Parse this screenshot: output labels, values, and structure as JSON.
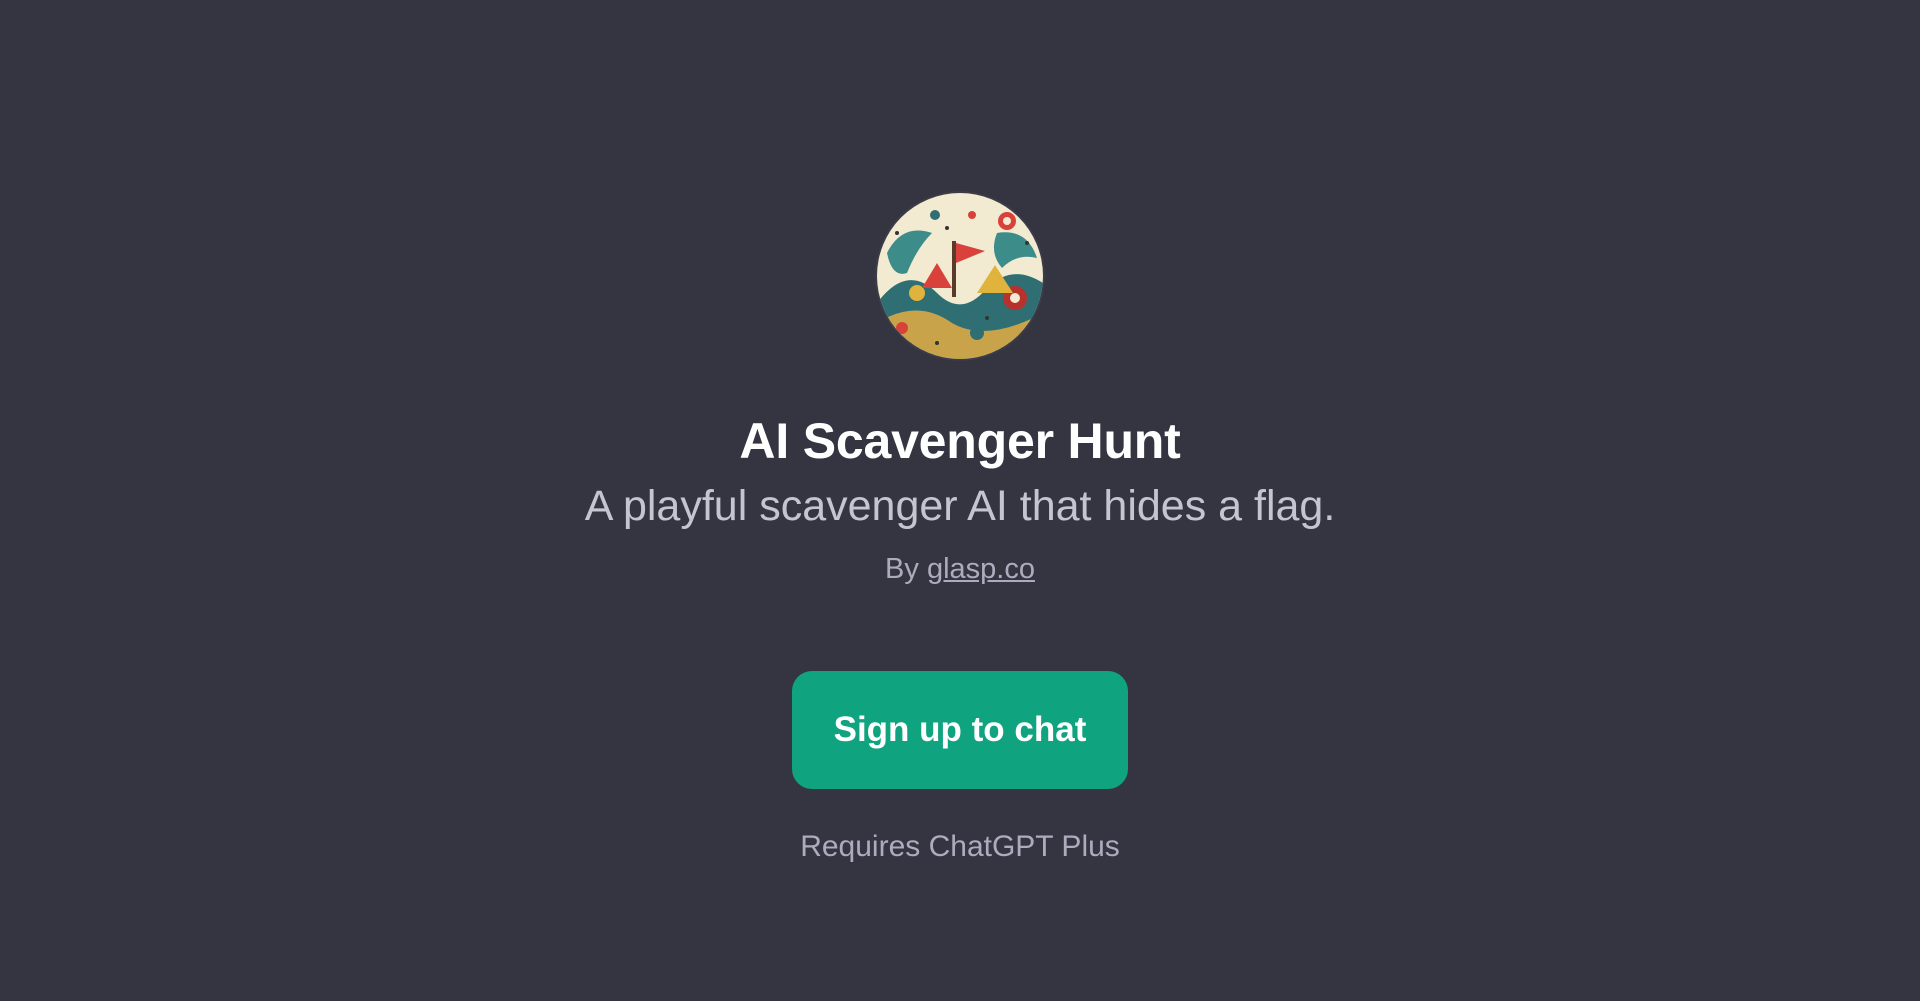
{
  "gpt": {
    "avatar_icon": "scavenger-hunt-illustration-icon",
    "name": "AI Scavenger Hunt",
    "description": "A playful scavenger AI that hides a flag.",
    "byline_prefix": "By",
    "author": "glasp.co"
  },
  "actions": {
    "signup_label": "Sign up to chat",
    "requirement": "Requires ChatGPT Plus"
  },
  "colors": {
    "background": "#343541",
    "accent": "#10a37f",
    "title": "#ffffff",
    "subtitle": "#c5c5d2",
    "muted": "#acacbe"
  }
}
